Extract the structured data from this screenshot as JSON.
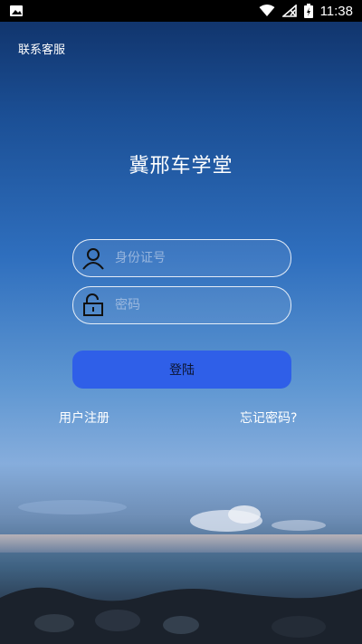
{
  "status": {
    "time": "11:38"
  },
  "header": {
    "contact": "联系客服"
  },
  "app": {
    "title": "冀邢车学堂"
  },
  "form": {
    "id_placeholder": "身份证号",
    "password_placeholder": "密码",
    "login_label": "登陆"
  },
  "links": {
    "register": "用户注册",
    "forgot": "忘记密码?"
  },
  "colors": {
    "login_button": "#2f5fe8"
  },
  "icons": {
    "image": "image-icon",
    "wifi": "wifi-icon",
    "signal": "signal-off-icon",
    "battery": "battery-charging-icon",
    "user": "user-icon",
    "lock": "unlock-icon"
  }
}
